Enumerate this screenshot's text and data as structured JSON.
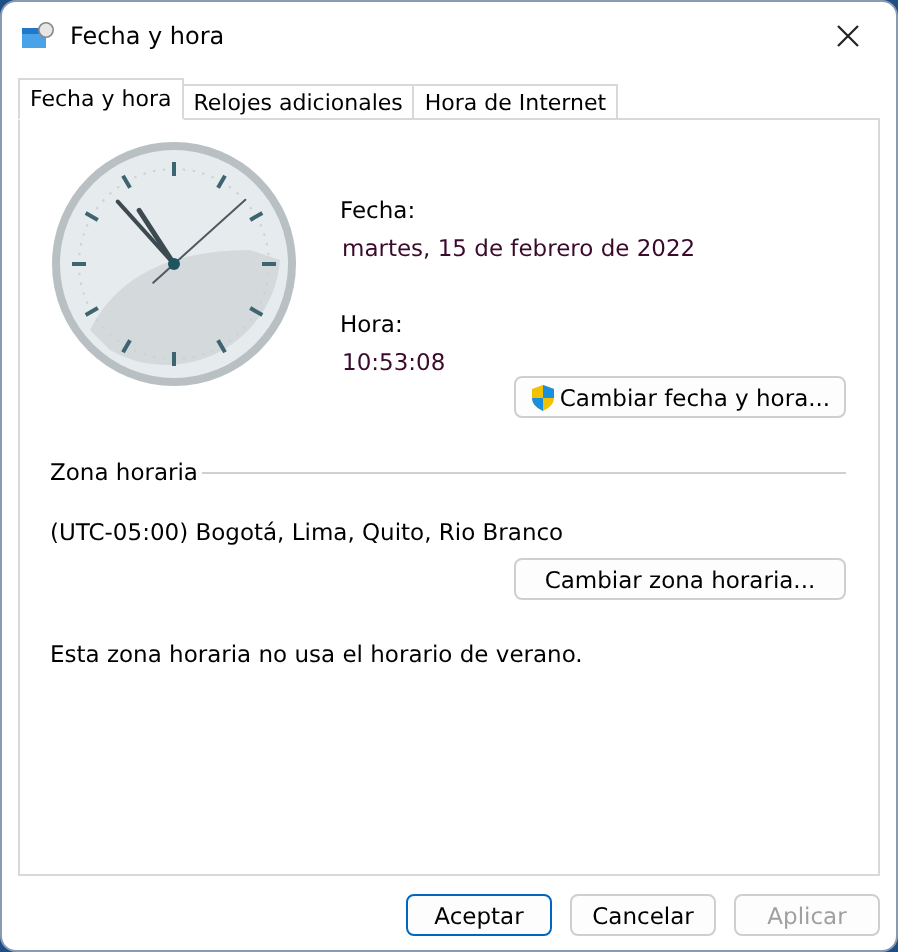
{
  "window": {
    "title": "Fecha y hora"
  },
  "tabs": [
    {
      "label": "Fecha y hora",
      "selected": true
    },
    {
      "label": "Relojes adicionales",
      "selected": false
    },
    {
      "label": "Hora de Internet",
      "selected": false
    }
  ],
  "date": {
    "label": "Fecha:",
    "value": "martes, 15 de febrero de 2022"
  },
  "time": {
    "label": "Hora:",
    "value": "10:53:08"
  },
  "change_datetime_button": {
    "label": "Cambiar fecha y hora..."
  },
  "time_zone": {
    "title": "Zona horaria",
    "zone": "(UTC-05:00) Bogotá, Lima, Quito, Rio Branco",
    "button": "Cambiar zona horaria...",
    "note": "Esta zona horaria no usa el horario de verano."
  },
  "buttons": [
    {
      "label": "Aceptar",
      "kind": "default",
      "disabled": false
    },
    {
      "label": "Cancelar",
      "kind": "normal",
      "disabled": false
    },
    {
      "label": "Aplicar",
      "kind": "normal",
      "disabled": true
    }
  ]
}
